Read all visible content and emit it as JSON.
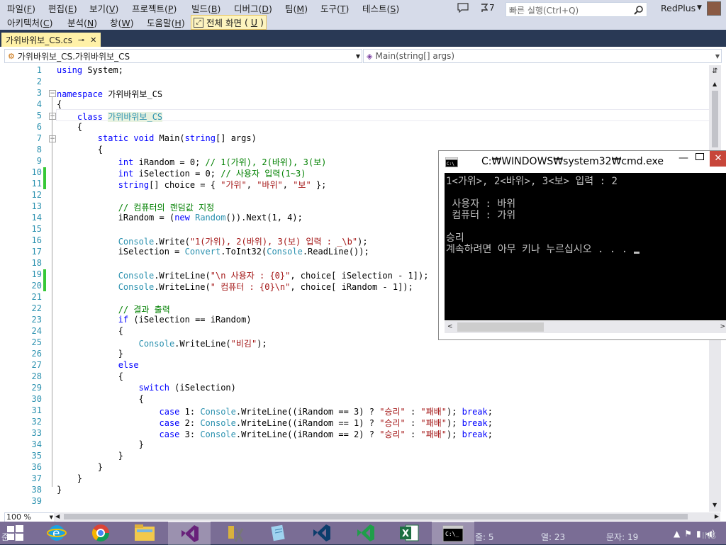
{
  "menu": {
    "row1": [
      {
        "label": "파일",
        "key": "F"
      },
      {
        "label": "편집",
        "key": "E"
      },
      {
        "label": "보기",
        "key": "V"
      },
      {
        "label": "프로젝트",
        "key": "P"
      },
      {
        "label": "빌드",
        "key": "B"
      },
      {
        "label": "디버그",
        "key": "D"
      },
      {
        "label": "팀",
        "key": "M"
      },
      {
        "label": "도구",
        "key": "T"
      },
      {
        "label": "테스트",
        "key": "S"
      }
    ],
    "row2": [
      {
        "label": "아키텍처",
        "key": "C"
      },
      {
        "label": "분석",
        "key": "N"
      },
      {
        "label": "창",
        "key": "W"
      },
      {
        "label": "도움말",
        "key": "H"
      }
    ],
    "fullscreen_label": "전체 화면",
    "fullscreen_key": "U"
  },
  "topbar": {
    "notifications": "7",
    "search_placeholder": "빠른 실행(Ctrl+Q)",
    "user": "RedPlus"
  },
  "tab": {
    "label": "가위바위보_CS.cs",
    "pin": "⊸"
  },
  "nav": {
    "left": "가위바위보_CS.가위바위보_CS",
    "right": "Main(string[] args)"
  },
  "code": {
    "line_numbers": [
      "1",
      "2",
      "3",
      "4",
      "5",
      "6",
      "7",
      "8",
      "9",
      "10",
      "11",
      "12",
      "13",
      "14",
      "15",
      "16",
      "17",
      "18",
      "19",
      "20",
      "21",
      "22",
      "23",
      "24",
      "25",
      "26",
      "27",
      "28",
      "29",
      "30",
      "31",
      "32",
      "33",
      "34",
      "35",
      "36",
      "37",
      "38",
      "39"
    ],
    "l1_kw": "using",
    "l1_rest": " System;",
    "l3_kw": "namespace",
    "l3_rest": " 가위바위보_CS",
    "l4": "{",
    "l5_kw": "class",
    "l5_ty": "가위바위보_CS",
    "l6": "{",
    "l7_kw1": "static",
    "l7_kw2": "void",
    "l7_a": " Main(",
    "l7_kw3": "string",
    "l7_b": "[] args)",
    "l8": "{",
    "l9_kw": "int",
    "l9_a": " iRandom = 0; ",
    "l9_cm": "// 1(가위), 2(바위), 3(보)",
    "l10_kw": "int",
    "l10_a": " iSelection = 0; ",
    "l10_cm": "// 사용자 입력(1~3)",
    "l11_kw": "string",
    "l11_a": "[] choice = { ",
    "l11_s1": "\"가위\"",
    "l11_c1": ", ",
    "l11_s2": "\"바위\"",
    "l11_c2": ", ",
    "l11_s3": "\"보\"",
    "l11_end": " };",
    "l13_cm": "// 컴퓨터의 랜덤값 지정",
    "l14_a": "iRandom = (",
    "l14_kw": "new",
    "l14_ty": "Random",
    "l14_b": "()).Next(1, 4);",
    "l16_ty": "Console",
    "l16_a": ".Write(",
    "l16_s": "\"1(가위), 2(바위), 3(보) 입력 : _\\b\"",
    "l16_b": ");",
    "l17_a": "iSelection = ",
    "l17_ty1": "Convert",
    "l17_b": ".ToInt32(",
    "l17_ty2": "Console",
    "l17_c": ".ReadLine());",
    "l19_ty": "Console",
    "l19_a": ".WriteLine(",
    "l19_s": "\"\\n 사용자 : {0}\"",
    "l19_b": ", choice[ iSelection - 1]);",
    "l20_ty": "Console",
    "l20_a": ".WriteLine(",
    "l20_s": "\" 컴퓨터 : {0}\\n\"",
    "l20_b": ", choice[ iRandom - 1]);",
    "l22_cm": "// 결과 출력",
    "l23_kw": "if",
    "l23_a": " (iSelection == iRandom)",
    "l24": "{",
    "l25_ty": "Console",
    "l25_a": ".WriteLine(",
    "l25_s": "\"비김\"",
    "l25_b": ");",
    "l26": "}",
    "l27_kw": "else",
    "l28": "{",
    "l29_kw": "switch",
    "l29_a": " (iSelection)",
    "l30": "{",
    "l31_kw": "case",
    "l31_a": " 1: ",
    "l31_ty": "Console",
    "l31_b": ".WriteLine((iRandom == 3) ? ",
    "l31_s1": "\"승리\"",
    "l31_c": " : ",
    "l31_s2": "\"패배\"",
    "l31_d": "); ",
    "l31_kw2": "break",
    ";": ";",
    "l32_kw": "case",
    "l32_a": " 2: ",
    "l32_ty": "Console",
    "l32_b": ".WriteLine((iRandom == 1) ? ",
    "l32_s1": "\"승리\"",
    "l32_c": " : ",
    "l32_s2": "\"패배\"",
    "l32_d": "); ",
    "l32_kw2": "break",
    "l33_kw": "case",
    "l33_a": " 3: ",
    "l33_ty": "Console",
    "l33_b": ".WriteLine((iRandom == 2) ? ",
    "l33_s1": "\"승리\"",
    "l33_c": " : ",
    "l33_s2": "\"패배\"",
    "l33_d": "); ",
    "l33_kw2": "break",
    "semi": ";",
    "l34": "}",
    "l35": "}",
    "l36": "}",
    "l37": "}",
    "l38": "}"
  },
  "cmd": {
    "title": "C:₩WINDOWS₩system32₩cmd.exe",
    "line1": "1<가위>, 2<바위>, 3<보> 입력 : 2",
    "line2": " 사용자 : 바위",
    "line3": " 컴퓨터 : 가위",
    "line4": "승리",
    "line5": "계속하려면 아무 키나 누르십시오 . . . "
  },
  "statusbar": {
    "zoom": "100 %",
    "ready": "준비",
    "line": "줄: 5",
    "col": "열: 23",
    "ch": "문자: 19",
    "ins": "INS"
  },
  "colors": {
    "vs_purple": "#68217a",
    "taskbar": "#7a6d95",
    "keyword": "#0000ff",
    "type": "#2b91af",
    "string": "#a31515",
    "comment": "#008000"
  }
}
